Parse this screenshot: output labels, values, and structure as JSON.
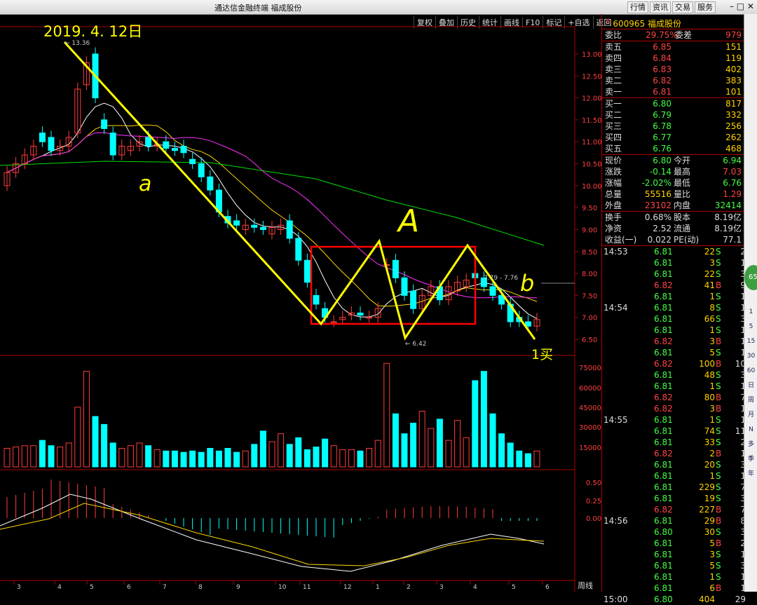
{
  "window": {
    "title": "通达信金融终端  福成股份",
    "menus": [
      "行情",
      "资讯",
      "交易",
      "服务"
    ]
  },
  "toolbar": [
    "复权",
    "叠加",
    "历史",
    "统计",
    "画线",
    "F10",
    "标记",
    "+自选",
    "返回"
  ],
  "chart": {
    "annot_date": "2019. 4. 12日",
    "annot_a": "a",
    "annot_A": "A",
    "annot_b": "b",
    "annot_buy": "1买",
    "high_label": "← 13.36",
    "low_label": "← 6.42",
    "range_label": "7.79 - 7.76",
    "price_ticks": [
      "13.00",
      "12.50",
      "12.00",
      "11.50",
      "11.00",
      "10.50",
      "10.00",
      "9.50",
      "9.00",
      "8.50",
      "8.00",
      "7.50",
      "7.00",
      "6.50"
    ],
    "vol_ticks": [
      "75000",
      "60000",
      "45000",
      "30000",
      "15000"
    ],
    "macd_ticks": [
      "0.50",
      "0.25",
      "0.00"
    ],
    "x_ticks": [
      "3",
      "4",
      "5",
      "6",
      "7",
      "8",
      "9",
      "10",
      "11",
      "12",
      "1",
      "2",
      "3",
      "4",
      "5",
      "6"
    ],
    "period": "周线",
    "colors": {
      "up": "#ff3b3b",
      "down": "#00ffff",
      "ma5": "#ffffff",
      "ma10": "#ffd700",
      "ma20": "#ff33ff",
      "ma60": "#00e000",
      "annotation": "#ffff00",
      "box": "#ff0000"
    }
  },
  "quote": {
    "code": "600965",
    "name": "福成股份",
    "weibi_label": "委比",
    "weibi": "29.75%",
    "weicha_label": "委差",
    "weicha": "979",
    "asks": [
      {
        "l": "卖五",
        "p": "6.85",
        "v": "151"
      },
      {
        "l": "卖四",
        "p": "6.84",
        "v": "119"
      },
      {
        "l": "卖三",
        "p": "6.83",
        "v": "402"
      },
      {
        "l": "卖二",
        "p": "6.82",
        "v": "383"
      },
      {
        "l": "卖一",
        "p": "6.81",
        "v": "101"
      }
    ],
    "bids": [
      {
        "l": "买一",
        "p": "6.80",
        "v": "817"
      },
      {
        "l": "买二",
        "p": "6.79",
        "v": "332"
      },
      {
        "l": "买三",
        "p": "6.78",
        "v": "256"
      },
      {
        "l": "买四",
        "p": "6.77",
        "v": "262"
      },
      {
        "l": "买五",
        "p": "6.76",
        "v": "468"
      }
    ],
    "stats": [
      {
        "a": "现价",
        "av": "6.80",
        "b": "今开",
        "bv": "6.94"
      },
      {
        "a": "涨跌",
        "av": "-0.14",
        "b": "最高",
        "bv": "7.03"
      },
      {
        "a": "涨幅",
        "av": "-2.02%",
        "b": "最低",
        "bv": "6.76"
      },
      {
        "a": "总量",
        "av": "55516",
        "b": "量比",
        "bv": "1.29"
      },
      {
        "a": "外盘",
        "av": "23102",
        "b": "内盘",
        "bv": "32414"
      }
    ],
    "stats2": [
      {
        "a": "换手",
        "av": "0.68%",
        "b": "股本",
        "bv": "8.19亿"
      },
      {
        "a": "净资",
        "av": "2.52",
        "b": "流通",
        "bv": "8.19亿"
      },
      {
        "a": "收益(一)",
        "av": "0.022",
        "b": "PE(动)",
        "bv": "77.1"
      }
    ],
    "ticks": [
      {
        "t": "14:53",
        "p": "6.81",
        "v": "22",
        "s": "S",
        "n": "2"
      },
      {
        "t": "",
        "p": "6.81",
        "v": "3",
        "s": "S",
        "n": "1"
      },
      {
        "t": "",
        "p": "6.81",
        "v": "22",
        "s": "S",
        "n": "3"
      },
      {
        "t": "",
        "p": "6.82",
        "v": "41",
        "s": "B",
        "n": "9"
      },
      {
        "t": "",
        "p": "6.81",
        "v": "1",
        "s": "S",
        "n": "1"
      },
      {
        "t": "14:54",
        "p": "6.81",
        "v": "8",
        "s": "S",
        "n": "1"
      },
      {
        "t": "",
        "p": "6.81",
        "v": "66",
        "s": "S",
        "n": "3"
      },
      {
        "t": "",
        "p": "6.81",
        "v": "1",
        "s": "S",
        "n": "1"
      },
      {
        "t": "",
        "p": "6.82",
        "v": "3",
        "s": "B",
        "n": "1"
      },
      {
        "t": "",
        "p": "6.81",
        "v": "5",
        "s": "S",
        "n": "1"
      },
      {
        "t": "",
        "p": "6.82",
        "v": "100",
        "s": "B",
        "n": "10"
      },
      {
        "t": "",
        "p": "6.81",
        "v": "48",
        "s": "S",
        "n": "3"
      },
      {
        "t": "",
        "p": "6.81",
        "v": "1",
        "s": "S",
        "n": "1"
      },
      {
        "t": "",
        "p": "6.82",
        "v": "80",
        "s": "B",
        "n": "7"
      },
      {
        "t": "",
        "p": "6.82",
        "v": "3",
        "s": "B",
        "n": "1"
      },
      {
        "t": "14:55",
        "p": "6.81",
        "v": "1",
        "s": "S",
        "n": "1"
      },
      {
        "t": "",
        "p": "6.81",
        "v": "74",
        "s": "S",
        "n": "11"
      },
      {
        "t": "",
        "p": "6.81",
        "v": "33",
        "s": "S",
        "n": "2"
      },
      {
        "t": "",
        "p": "6.82",
        "v": "2",
        "s": "B",
        "n": "1"
      },
      {
        "t": "",
        "p": "6.81",
        "v": "20",
        "s": "S",
        "n": "3"
      },
      {
        "t": "",
        "p": "6.81",
        "v": "1",
        "s": "S",
        "n": "1"
      },
      {
        "t": "",
        "p": "6.81",
        "v": "229",
        "s": "S",
        "n": "7"
      },
      {
        "t": "",
        "p": "6.81",
        "v": "19",
        "s": "S",
        "n": "3"
      },
      {
        "t": "",
        "p": "6.82",
        "v": "227",
        "s": "B",
        "n": "7"
      },
      {
        "t": "14:56",
        "p": "6.81",
        "v": "29",
        "s": "B",
        "n": "8"
      },
      {
        "t": "",
        "p": "6.80",
        "v": "30",
        "s": "S",
        "n": "3"
      },
      {
        "t": "",
        "p": "6.81",
        "v": "5",
        "s": "B",
        "n": "2"
      },
      {
        "t": "",
        "p": "6.81",
        "v": "3",
        "s": "S",
        "n": "1"
      },
      {
        "t": "",
        "p": "6.81",
        "v": "5",
        "s": "S",
        "n": "3"
      },
      {
        "t": "",
        "p": "6.81",
        "v": "1",
        "s": "S",
        "n": "1"
      },
      {
        "t": "",
        "p": "6.81",
        "v": "6",
        "s": "B",
        "n": "1"
      },
      {
        "t": "15:00",
        "p": "6.80",
        "v": "404",
        "s": "",
        "n": "29"
      }
    ]
  },
  "sidebar": [
    "1",
    "5",
    "15",
    "30",
    "60",
    "日",
    "周",
    "月",
    "N",
    "多",
    "季",
    "年"
  ],
  "circle": "65"
}
